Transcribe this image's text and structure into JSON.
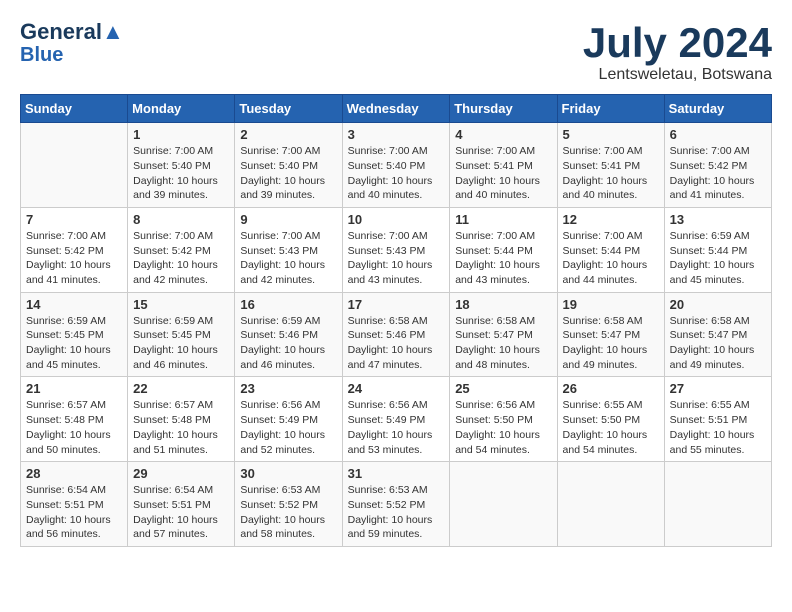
{
  "header": {
    "logo_line1": "General",
    "logo_line2": "Blue",
    "title": "July 2024",
    "subtitle": "Lentsweletau, Botswana"
  },
  "days_of_week": [
    "Sunday",
    "Monday",
    "Tuesday",
    "Wednesday",
    "Thursday",
    "Friday",
    "Saturday"
  ],
  "weeks": [
    [
      {
        "day": "",
        "info": ""
      },
      {
        "day": "1",
        "info": "Sunrise: 7:00 AM\nSunset: 5:40 PM\nDaylight: 10 hours\nand 39 minutes."
      },
      {
        "day": "2",
        "info": "Sunrise: 7:00 AM\nSunset: 5:40 PM\nDaylight: 10 hours\nand 39 minutes."
      },
      {
        "day": "3",
        "info": "Sunrise: 7:00 AM\nSunset: 5:40 PM\nDaylight: 10 hours\nand 40 minutes."
      },
      {
        "day": "4",
        "info": "Sunrise: 7:00 AM\nSunset: 5:41 PM\nDaylight: 10 hours\nand 40 minutes."
      },
      {
        "day": "5",
        "info": "Sunrise: 7:00 AM\nSunset: 5:41 PM\nDaylight: 10 hours\nand 40 minutes."
      },
      {
        "day": "6",
        "info": "Sunrise: 7:00 AM\nSunset: 5:42 PM\nDaylight: 10 hours\nand 41 minutes."
      }
    ],
    [
      {
        "day": "7",
        "info": "Sunrise: 7:00 AM\nSunset: 5:42 PM\nDaylight: 10 hours\nand 41 minutes."
      },
      {
        "day": "8",
        "info": "Sunrise: 7:00 AM\nSunset: 5:42 PM\nDaylight: 10 hours\nand 42 minutes."
      },
      {
        "day": "9",
        "info": "Sunrise: 7:00 AM\nSunset: 5:43 PM\nDaylight: 10 hours\nand 42 minutes."
      },
      {
        "day": "10",
        "info": "Sunrise: 7:00 AM\nSunset: 5:43 PM\nDaylight: 10 hours\nand 43 minutes."
      },
      {
        "day": "11",
        "info": "Sunrise: 7:00 AM\nSunset: 5:44 PM\nDaylight: 10 hours\nand 43 minutes."
      },
      {
        "day": "12",
        "info": "Sunrise: 7:00 AM\nSunset: 5:44 PM\nDaylight: 10 hours\nand 44 minutes."
      },
      {
        "day": "13",
        "info": "Sunrise: 6:59 AM\nSunset: 5:44 PM\nDaylight: 10 hours\nand 45 minutes."
      }
    ],
    [
      {
        "day": "14",
        "info": "Sunrise: 6:59 AM\nSunset: 5:45 PM\nDaylight: 10 hours\nand 45 minutes."
      },
      {
        "day": "15",
        "info": "Sunrise: 6:59 AM\nSunset: 5:45 PM\nDaylight: 10 hours\nand 46 minutes."
      },
      {
        "day": "16",
        "info": "Sunrise: 6:59 AM\nSunset: 5:46 PM\nDaylight: 10 hours\nand 46 minutes."
      },
      {
        "day": "17",
        "info": "Sunrise: 6:58 AM\nSunset: 5:46 PM\nDaylight: 10 hours\nand 47 minutes."
      },
      {
        "day": "18",
        "info": "Sunrise: 6:58 AM\nSunset: 5:47 PM\nDaylight: 10 hours\nand 48 minutes."
      },
      {
        "day": "19",
        "info": "Sunrise: 6:58 AM\nSunset: 5:47 PM\nDaylight: 10 hours\nand 49 minutes."
      },
      {
        "day": "20",
        "info": "Sunrise: 6:58 AM\nSunset: 5:47 PM\nDaylight: 10 hours\nand 49 minutes."
      }
    ],
    [
      {
        "day": "21",
        "info": "Sunrise: 6:57 AM\nSunset: 5:48 PM\nDaylight: 10 hours\nand 50 minutes."
      },
      {
        "day": "22",
        "info": "Sunrise: 6:57 AM\nSunset: 5:48 PM\nDaylight: 10 hours\nand 51 minutes."
      },
      {
        "day": "23",
        "info": "Sunrise: 6:56 AM\nSunset: 5:49 PM\nDaylight: 10 hours\nand 52 minutes."
      },
      {
        "day": "24",
        "info": "Sunrise: 6:56 AM\nSunset: 5:49 PM\nDaylight: 10 hours\nand 53 minutes."
      },
      {
        "day": "25",
        "info": "Sunrise: 6:56 AM\nSunset: 5:50 PM\nDaylight: 10 hours\nand 54 minutes."
      },
      {
        "day": "26",
        "info": "Sunrise: 6:55 AM\nSunset: 5:50 PM\nDaylight: 10 hours\nand 54 minutes."
      },
      {
        "day": "27",
        "info": "Sunrise: 6:55 AM\nSunset: 5:51 PM\nDaylight: 10 hours\nand 55 minutes."
      }
    ],
    [
      {
        "day": "28",
        "info": "Sunrise: 6:54 AM\nSunset: 5:51 PM\nDaylight: 10 hours\nand 56 minutes."
      },
      {
        "day": "29",
        "info": "Sunrise: 6:54 AM\nSunset: 5:51 PM\nDaylight: 10 hours\nand 57 minutes."
      },
      {
        "day": "30",
        "info": "Sunrise: 6:53 AM\nSunset: 5:52 PM\nDaylight: 10 hours\nand 58 minutes."
      },
      {
        "day": "31",
        "info": "Sunrise: 6:53 AM\nSunset: 5:52 PM\nDaylight: 10 hours\nand 59 minutes."
      },
      {
        "day": "",
        "info": ""
      },
      {
        "day": "",
        "info": ""
      },
      {
        "day": "",
        "info": ""
      }
    ]
  ]
}
